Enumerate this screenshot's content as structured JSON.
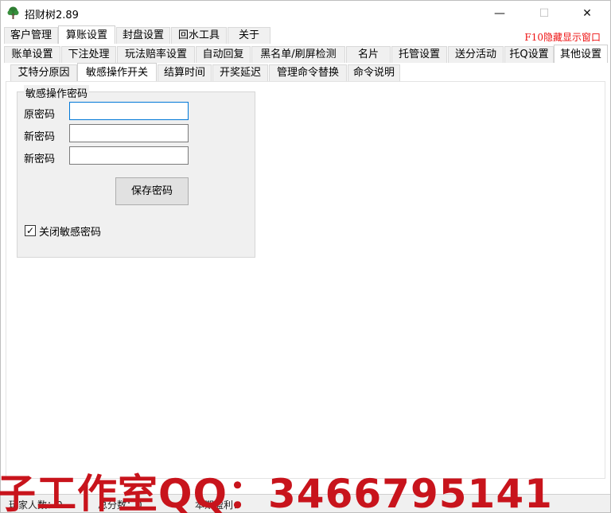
{
  "window": {
    "title": "招财树2.89",
    "min_glyph": "—",
    "max_glyph": "☐",
    "close_glyph": "✕"
  },
  "main_tabs": [
    {
      "label": "客户管理"
    },
    {
      "label": "算账设置"
    },
    {
      "label": "封盘设置"
    },
    {
      "label": "回水工具"
    },
    {
      "label": "关于"
    }
  ],
  "f10_note": "F10隐藏显示窗口",
  "sub_tabs": [
    {
      "label": "账单设置"
    },
    {
      "label": "下注处理"
    },
    {
      "label": "玩法赔率设置"
    },
    {
      "label": "自动回复"
    },
    {
      "label": "黑名单/刷屏检测"
    },
    {
      "label": "名片"
    },
    {
      "label": "托管设置"
    },
    {
      "label": "送分活动"
    },
    {
      "label": "托Q设置"
    },
    {
      "label": "其他设置"
    }
  ],
  "sub_sub_tabs": [
    {
      "label": "艾特分原因"
    },
    {
      "label": "敏感操作开关"
    },
    {
      "label": "结算时间"
    },
    {
      "label": "开奖延迟"
    },
    {
      "label": "管理命令替换"
    },
    {
      "label": "命令说明"
    }
  ],
  "password_group": {
    "title": "敏感操作密码",
    "old_password_label": "原密码",
    "new_password_label": "新密码",
    "confirm_password_label": "新密码",
    "old_password_value": "",
    "new_password_value": "",
    "confirm_password_value": "",
    "save_button_label": "保存密码",
    "disable_checkbox_label": "关闭敏感密码",
    "disable_checked": true
  },
  "statusbar": {
    "players_label": "玩家人数：0",
    "total_label": "总分数：0",
    "profit_label": "本期盈利："
  },
  "watermark": "子工作室QQ：3466795141",
  "colors": {
    "accent_red": "#e11111",
    "watermark_red": "#c8141c",
    "focus_blue": "#0078d7",
    "tree_green": "#2e7d32"
  }
}
